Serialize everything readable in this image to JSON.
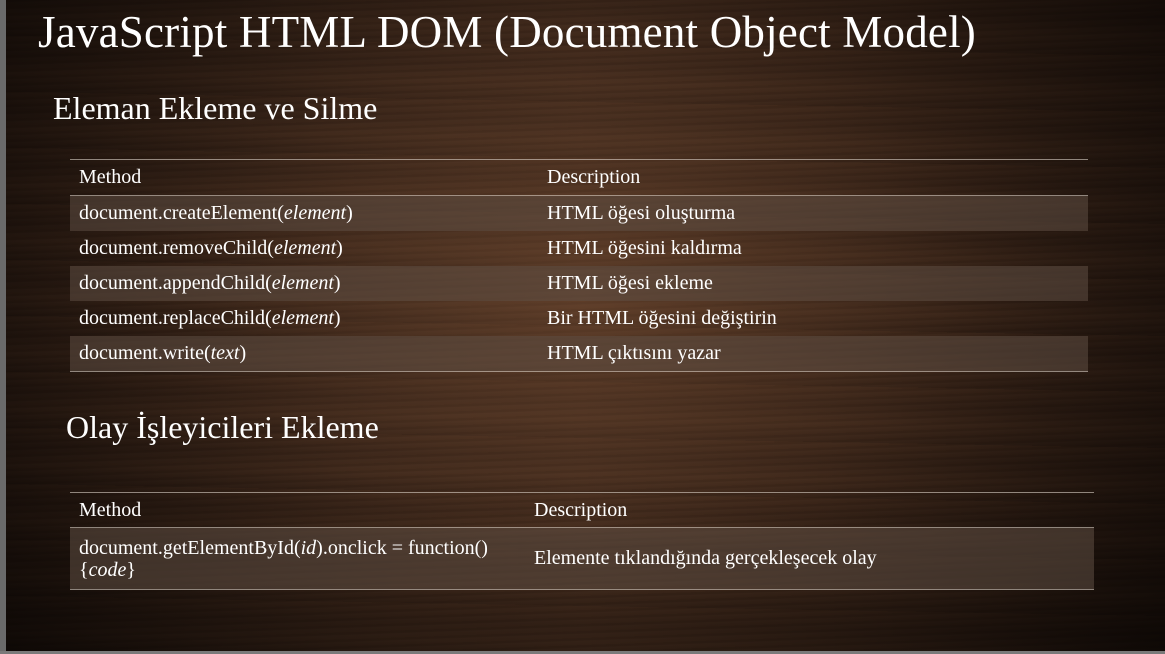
{
  "slide": {
    "title": "JavaScript HTML DOM (Document Object Model)",
    "section1": {
      "heading": "Eleman Ekleme ve Silme",
      "header": {
        "method": "Method",
        "description": "Description"
      },
      "rows": [
        {
          "method_prefix": "document.createElement(",
          "method_arg": "element",
          "method_suffix": ")",
          "description": "HTML öğesi oluşturma"
        },
        {
          "method_prefix": "document.removeChild(",
          "method_arg": "element",
          "method_suffix": ")",
          "description": "HTML öğesini kaldırma"
        },
        {
          "method_prefix": "document.appendChild(",
          "method_arg": "element",
          "method_suffix": ")",
          "description": "HTML öğesi ekleme"
        },
        {
          "method_prefix": "document.replaceChild(",
          "method_arg": "element",
          "method_suffix": ")",
          "description": "Bir HTML öğesini değiştirin"
        },
        {
          "method_prefix": "document.write(",
          "method_arg": "text",
          "method_suffix": ")",
          "description": "HTML çıktısını yazar"
        }
      ]
    },
    "section2": {
      "heading": "Olay İşleyicileri Ekleme",
      "header": {
        "method": "Method",
        "description": "Description"
      },
      "rows": [
        {
          "method_prefix": "document.getElementById(",
          "method_arg": "id",
          "method_mid": ").onclick = function(){",
          "method_arg2": "code",
          "method_suffix": "}",
          "description": "Elemente tıklandığında  gerçekleşecek olay"
        }
      ]
    }
  }
}
